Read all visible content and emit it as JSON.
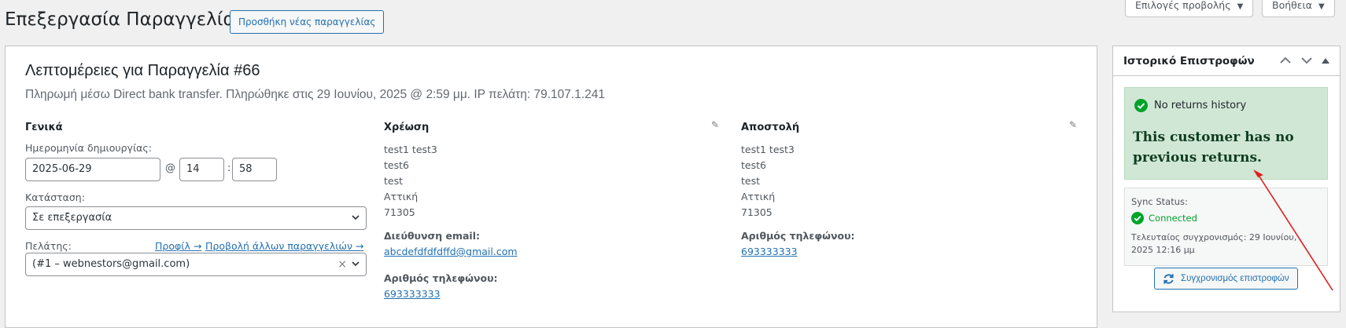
{
  "page": {
    "title": "Επεξεργασία Παραγγελίας",
    "add_new_label": "Προσθήκη νέας παραγγελίας"
  },
  "screen_tabs": {
    "screen_options": "Επιλογές προβολής",
    "help": "Βοήθεια"
  },
  "order": {
    "heading": "Λεπτομέρειες για Παραγγελία #66",
    "subheading": "Πληρωμή μέσω Direct bank transfer. Πληρώθηκε στις 29 Ιουνίου, 2025 @ 2:59 μμ. IP πελάτη: 79.107.1.241",
    "general": {
      "title": "Γενικά",
      "date_label": "Ημερομηνία δημιουργίας:",
      "date_value": "2025-06-29",
      "at": "@",
      "hour": "14",
      "colon": ":",
      "minute": "58",
      "status_label": "Κατάσταση:",
      "status_value": "Σε επεξεργασία",
      "customer_label": "Πελάτης:",
      "profile_link": "Προφίλ →",
      "other_orders_link": "Προβολή άλλων παραγγελιών →",
      "customer_value": "(#1 – webnestors@gmail.com)",
      "clear": "×"
    },
    "billing": {
      "title": "Χρέωση",
      "lines": [
        "test1 test3",
        "test6",
        "test",
        "Αττική",
        "71305"
      ],
      "email_label": "Διεύθυνση email:",
      "email": "abcdefdfdfdffd@gmail.com",
      "phone_label": "Αριθμός τηλεφώνου:",
      "phone": "693333333"
    },
    "shipping": {
      "title": "Αποστολή",
      "lines": [
        "test1 test3",
        "test6",
        "test",
        "Αττική",
        "71305"
      ],
      "phone_label": "Αριθμός τηλεφώνου:",
      "phone": "693333333"
    }
  },
  "returns": {
    "title": "Ιστορικό Επιστροφών",
    "notice_head": "No returns history",
    "notice_body": "This customer has no previous returns.",
    "sync_label": "Sync Status:",
    "sync_status": "Connected",
    "last_sync": "Τελευταίος συγχρονισμός: 29 Ιουνίου, 2025 12:16 μμ",
    "sync_button": "Συγχρονισμός επιστροφών"
  },
  "colors": {
    "accent": "#2271b1",
    "success": "#00a32a",
    "annotation": "#e11d1d"
  }
}
